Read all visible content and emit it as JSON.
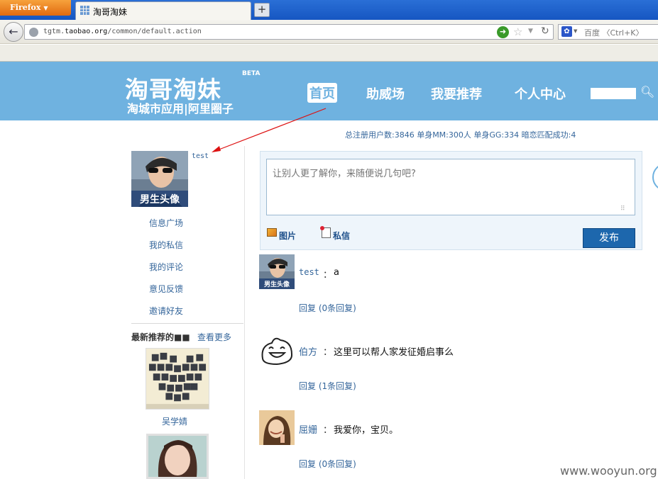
{
  "browser": {
    "menu_button": "Firefox",
    "tab_title": "淘哥淘妹",
    "new_tab": "+",
    "url_prefix": "tgtm.",
    "url_domain": "taobao.org",
    "url_path": "/common/default.action",
    "search_engine": "百度",
    "search_placeholder": "百度 〈Ctrl+K〉"
  },
  "site": {
    "logo": "淘哥淘妹",
    "logo_badge": "BETA",
    "tagline": "淘城市应用|阿里圈子",
    "nav": [
      "首页",
      "助威场",
      "我要推荐",
      "个人中心"
    ],
    "stats": "总注册用户数:3846  单身MM:300人  单身GG:334  暗恋匹配成功:4",
    "accent_color": "#6fb2e0",
    "link_color": "#35669b"
  },
  "sidebar": {
    "username": "test",
    "avatar_caption": "男生头像",
    "menu": [
      "信息广场",
      "我的私信",
      "我的评论",
      "意见反馈",
      "邀请好友"
    ],
    "recommend_title": "最新推荐的■■",
    "recommend_more": "查看更多",
    "recommend_name": "吴学婧"
  },
  "post_box": {
    "placeholder": "让别人更了解你，来随便说几句吧?",
    "picture_label": "图片",
    "pm_label": "私信",
    "publish_label": "发布"
  },
  "feed": [
    {
      "name": "test",
      "colon": "：",
      "text": "a",
      "reply": "回复  (0条回复)",
      "avatar": "男生头像"
    },
    {
      "name": "伯方",
      "colon": "：",
      "text": "这里可以帮人家发征婚启事么",
      "reply": "回复  (1条回复)",
      "avatar": "smiley-bun"
    },
    {
      "name": "屈姗",
      "colon": "：",
      "text": "我爱你，宝贝。",
      "reply": "回复  (0条回复)",
      "avatar": "girl-photo"
    }
  ],
  "watermark": "www.wooyun.org"
}
